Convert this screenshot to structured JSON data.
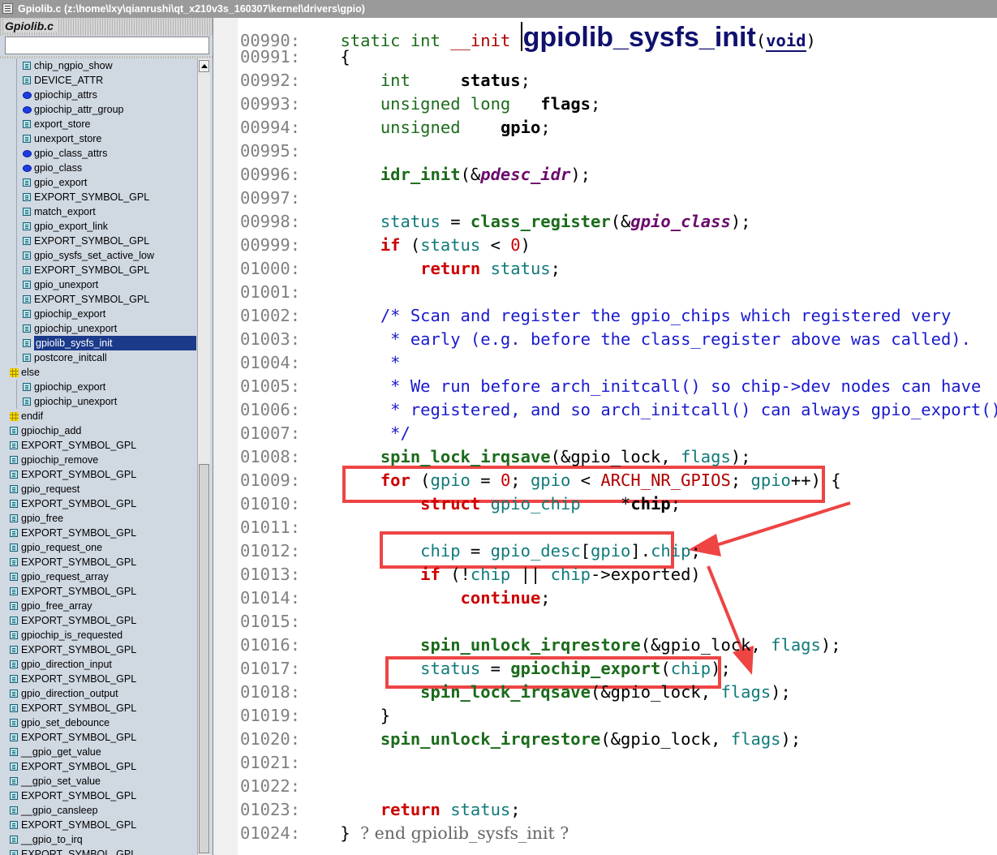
{
  "window": {
    "title": "Gpiolib.c (z:\\home\\lxy\\qianrushi\\qt_x210v3s_160307\\kernel\\drivers\\gpio)"
  },
  "sidebar": {
    "title": "Gpiolib.c",
    "search_value": "",
    "items": [
      {
        "label": "chip_ngpio_show",
        "icon": "function-icon",
        "indent": 2,
        "selected": false
      },
      {
        "label": "DEVICE_ATTR",
        "icon": "function-icon",
        "indent": 2,
        "selected": false
      },
      {
        "label": "gpiochip_attrs",
        "icon": "variable-icon",
        "indent": 2,
        "selected": false
      },
      {
        "label": "gpiochip_attr_group",
        "icon": "variable-icon",
        "indent": 2,
        "selected": false
      },
      {
        "label": "export_store",
        "icon": "function-icon",
        "indent": 2,
        "selected": false
      },
      {
        "label": "unexport_store",
        "icon": "function-icon",
        "indent": 2,
        "selected": false
      },
      {
        "label": "gpio_class_attrs",
        "icon": "variable-icon",
        "indent": 2,
        "selected": false
      },
      {
        "label": "gpio_class",
        "icon": "variable-icon",
        "indent": 2,
        "selected": false
      },
      {
        "label": "gpio_export",
        "icon": "function-icon",
        "indent": 2,
        "selected": false
      },
      {
        "label": "EXPORT_SYMBOL_GPL",
        "icon": "function-icon",
        "indent": 2,
        "selected": false
      },
      {
        "label": "match_export",
        "icon": "function-icon",
        "indent": 2,
        "selected": false
      },
      {
        "label": "gpio_export_link",
        "icon": "function-icon",
        "indent": 2,
        "selected": false
      },
      {
        "label": "EXPORT_SYMBOL_GPL",
        "icon": "function-icon",
        "indent": 2,
        "selected": false
      },
      {
        "label": "gpio_sysfs_set_active_low",
        "icon": "function-icon",
        "indent": 2,
        "selected": false
      },
      {
        "label": "EXPORT_SYMBOL_GPL",
        "icon": "function-icon",
        "indent": 2,
        "selected": false
      },
      {
        "label": "gpio_unexport",
        "icon": "function-icon",
        "indent": 2,
        "selected": false
      },
      {
        "label": "EXPORT_SYMBOL_GPL",
        "icon": "function-icon",
        "indent": 2,
        "selected": false
      },
      {
        "label": "gpiochip_export",
        "icon": "function-icon",
        "indent": 2,
        "selected": false
      },
      {
        "label": "gpiochip_unexport",
        "icon": "function-icon",
        "indent": 2,
        "selected": false
      },
      {
        "label": "gpiolib_sysfs_init",
        "icon": "function-icon",
        "indent": 2,
        "selected": true
      },
      {
        "label": "postcore_initcall",
        "icon": "function-icon",
        "indent": 2,
        "selected": false
      },
      {
        "label": "else",
        "icon": "preprocessor-icon",
        "indent": 0,
        "selected": false
      },
      {
        "label": "gpiochip_export",
        "icon": "function-icon",
        "indent": 2,
        "selected": false
      },
      {
        "label": "gpiochip_unexport",
        "icon": "function-icon",
        "indent": 2,
        "selected": false
      },
      {
        "label": "endif",
        "icon": "preprocessor-icon",
        "indent": 0,
        "selected": false
      },
      {
        "label": "gpiochip_add",
        "icon": "function-icon",
        "indent": 1,
        "selected": false
      },
      {
        "label": "EXPORT_SYMBOL_GPL",
        "icon": "function-icon",
        "indent": 1,
        "selected": false
      },
      {
        "label": "gpiochip_remove",
        "icon": "function-icon",
        "indent": 1,
        "selected": false
      },
      {
        "label": "EXPORT_SYMBOL_GPL",
        "icon": "function-icon",
        "indent": 1,
        "selected": false
      },
      {
        "label": "gpio_request",
        "icon": "function-icon",
        "indent": 1,
        "selected": false
      },
      {
        "label": "EXPORT_SYMBOL_GPL",
        "icon": "function-icon",
        "indent": 1,
        "selected": false
      },
      {
        "label": "gpio_free",
        "icon": "function-icon",
        "indent": 1,
        "selected": false
      },
      {
        "label": "EXPORT_SYMBOL_GPL",
        "icon": "function-icon",
        "indent": 1,
        "selected": false
      },
      {
        "label": "gpio_request_one",
        "icon": "function-icon",
        "indent": 1,
        "selected": false
      },
      {
        "label": "EXPORT_SYMBOL_GPL",
        "icon": "function-icon",
        "indent": 1,
        "selected": false
      },
      {
        "label": "gpio_request_array",
        "icon": "function-icon",
        "indent": 1,
        "selected": false
      },
      {
        "label": "EXPORT_SYMBOL_GPL",
        "icon": "function-icon",
        "indent": 1,
        "selected": false
      },
      {
        "label": "gpio_free_array",
        "icon": "function-icon",
        "indent": 1,
        "selected": false
      },
      {
        "label": "EXPORT_SYMBOL_GPL",
        "icon": "function-icon",
        "indent": 1,
        "selected": false
      },
      {
        "label": "gpiochip_is_requested",
        "icon": "function-icon",
        "indent": 1,
        "selected": false
      },
      {
        "label": "EXPORT_SYMBOL_GPL",
        "icon": "function-icon",
        "indent": 1,
        "selected": false
      },
      {
        "label": "gpio_direction_input",
        "icon": "function-icon",
        "indent": 1,
        "selected": false
      },
      {
        "label": "EXPORT_SYMBOL_GPL",
        "icon": "function-icon",
        "indent": 1,
        "selected": false
      },
      {
        "label": "gpio_direction_output",
        "icon": "function-icon",
        "indent": 1,
        "selected": false
      },
      {
        "label": "EXPORT_SYMBOL_GPL",
        "icon": "function-icon",
        "indent": 1,
        "selected": false
      },
      {
        "label": "gpio_set_debounce",
        "icon": "function-icon",
        "indent": 1,
        "selected": false
      },
      {
        "label": "EXPORT_SYMBOL_GPL",
        "icon": "function-icon",
        "indent": 1,
        "selected": false
      },
      {
        "label": "__gpio_get_value",
        "icon": "function-icon",
        "indent": 1,
        "selected": false
      },
      {
        "label": "EXPORT_SYMBOL_GPL",
        "icon": "function-icon",
        "indent": 1,
        "selected": false
      },
      {
        "label": "__gpio_set_value",
        "icon": "function-icon",
        "indent": 1,
        "selected": false
      },
      {
        "label": "EXPORT_SYMBOL_GPL",
        "icon": "function-icon",
        "indent": 1,
        "selected": false
      },
      {
        "label": "__gpio_cansleep",
        "icon": "function-icon",
        "indent": 1,
        "selected": false
      },
      {
        "label": "EXPORT_SYMBOL_GPL",
        "icon": "function-icon",
        "indent": 1,
        "selected": false
      },
      {
        "label": "__gpio_to_irq",
        "icon": "function-icon",
        "indent": 1,
        "selected": false
      },
      {
        "label": "EXPORT_SYMBOL_GPL",
        "icon": "function-icon",
        "indent": 1,
        "selected": false
      }
    ]
  },
  "editor": {
    "annotation_color": "#ee4444",
    "lines": [
      {
        "num": "00990",
        "tokens": [
          [
            "    ",
            "op"
          ],
          [
            "static",
            "kw"
          ],
          [
            " ",
            "op"
          ],
          [
            "int",
            "kw"
          ],
          [
            " ",
            "op"
          ],
          [
            "__init",
            "mac"
          ],
          [
            " ",
            "op"
          ],
          [
            "|cursor",
            "cursor"
          ],
          [
            "gpiolib_sysfs_init",
            "big"
          ],
          [
            "(",
            "op"
          ],
          [
            "void",
            "voidw"
          ],
          [
            ")",
            "op"
          ]
        ]
      },
      {
        "num": "00991",
        "tokens": [
          [
            "    {",
            "op"
          ]
        ]
      },
      {
        "num": "00992",
        "tokens": [
          [
            "        ",
            "op"
          ],
          [
            "int",
            "ty"
          ],
          [
            "     ",
            "op"
          ],
          [
            "status",
            "var"
          ],
          [
            ";",
            "op"
          ]
        ]
      },
      {
        "num": "00993",
        "tokens": [
          [
            "        ",
            "op"
          ],
          [
            "unsigned long",
            "ty"
          ],
          [
            "   ",
            "op"
          ],
          [
            "flags",
            "var"
          ],
          [
            ";",
            "op"
          ]
        ]
      },
      {
        "num": "00994",
        "tokens": [
          [
            "        ",
            "op"
          ],
          [
            "unsigned",
            "ty"
          ],
          [
            "    ",
            "op"
          ],
          [
            "gpio",
            "var"
          ],
          [
            ";",
            "op"
          ]
        ]
      },
      {
        "num": "00995",
        "tokens": []
      },
      {
        "num": "00996",
        "tokens": [
          [
            "        ",
            "op"
          ],
          [
            "idr_init",
            "fn"
          ],
          [
            "(&",
            "op"
          ],
          [
            "pdesc_idr",
            "gv"
          ],
          [
            ");",
            "op"
          ]
        ]
      },
      {
        "num": "00997",
        "tokens": []
      },
      {
        "num": "00998",
        "tokens": [
          [
            "        ",
            "op"
          ],
          [
            "status",
            "id"
          ],
          [
            " = ",
            "op"
          ],
          [
            "class_register",
            "fn"
          ],
          [
            "(&",
            "op"
          ],
          [
            "gpio_class",
            "gv"
          ],
          [
            ");",
            "op"
          ]
        ]
      },
      {
        "num": "00999",
        "tokens": [
          [
            "        ",
            "op"
          ],
          [
            "if",
            "kwr"
          ],
          [
            " (",
            "op"
          ],
          [
            "status",
            "id"
          ],
          [
            " < ",
            "op"
          ],
          [
            "0",
            "num"
          ],
          [
            ")",
            "op"
          ]
        ]
      },
      {
        "num": "01000",
        "tokens": [
          [
            "            ",
            "op"
          ],
          [
            "return",
            "kwr"
          ],
          [
            " ",
            "op"
          ],
          [
            "status",
            "id"
          ],
          [
            ";",
            "op"
          ]
        ]
      },
      {
        "num": "01001",
        "tokens": []
      },
      {
        "num": "01002",
        "tokens": [
          [
            "        ",
            "op"
          ],
          [
            "/* Scan and register the gpio_chips which registered very",
            "cm"
          ]
        ]
      },
      {
        "num": "01003",
        "tokens": [
          [
            "         ",
            "op"
          ],
          [
            "* early (e.g. before the class_register above was called).",
            "cm"
          ]
        ]
      },
      {
        "num": "01004",
        "tokens": [
          [
            "         ",
            "op"
          ],
          [
            "*",
            "cm"
          ]
        ]
      },
      {
        "num": "01005",
        "tokens": [
          [
            "         ",
            "op"
          ],
          [
            "* We run before arch_initcall() so chip->dev nodes can have",
            "cm"
          ]
        ]
      },
      {
        "num": "01006",
        "tokens": [
          [
            "         ",
            "op"
          ],
          [
            "* registered, and so arch_initcall() can always gpio_export().",
            "cm"
          ]
        ]
      },
      {
        "num": "01007",
        "tokens": [
          [
            "         ",
            "op"
          ],
          [
            "*/",
            "cm"
          ]
        ]
      },
      {
        "num": "01008",
        "tokens": [
          [
            "        ",
            "op"
          ],
          [
            "spin_lock_irqsave",
            "fn"
          ],
          [
            "(&gpio_lock, ",
            "op"
          ],
          [
            "flags",
            "id"
          ],
          [
            ");",
            "op"
          ]
        ]
      },
      {
        "num": "01009",
        "tokens": [
          [
            "        ",
            "op"
          ],
          [
            "for",
            "kwr"
          ],
          [
            " (",
            "op"
          ],
          [
            "gpio",
            "id"
          ],
          [
            " = ",
            "op"
          ],
          [
            "0",
            "num"
          ],
          [
            "; ",
            "op"
          ],
          [
            "gpio",
            "id"
          ],
          [
            " < ",
            "op"
          ],
          [
            "ARCH_NR_GPIOS",
            "mac"
          ],
          [
            "; ",
            "op"
          ],
          [
            "gpio",
            "id"
          ],
          [
            "++) {",
            "op"
          ]
        ]
      },
      {
        "num": "01010",
        "tokens": [
          [
            "            ",
            "op"
          ],
          [
            "struct",
            "kwr"
          ],
          [
            " ",
            "op"
          ],
          [
            "gpio_chip",
            "id"
          ],
          [
            "    *",
            "op"
          ],
          [
            "chip",
            "var"
          ],
          [
            ";",
            "op"
          ]
        ]
      },
      {
        "num": "01011",
        "tokens": []
      },
      {
        "num": "01012",
        "tokens": [
          [
            "            ",
            "op"
          ],
          [
            "chip",
            "id"
          ],
          [
            " = ",
            "op"
          ],
          [
            "gpio_desc",
            "id"
          ],
          [
            "[",
            "op"
          ],
          [
            "gpio",
            "id"
          ],
          [
            "].",
            "op"
          ],
          [
            "chip",
            "id"
          ],
          [
            ";",
            "op"
          ]
        ]
      },
      {
        "num": "01013",
        "tokens": [
          [
            "            ",
            "op"
          ],
          [
            "if",
            "kwr"
          ],
          [
            " (!",
            "op"
          ],
          [
            "chip",
            "id"
          ],
          [
            " || ",
            "op"
          ],
          [
            "chip",
            "id"
          ],
          [
            "->exported)",
            "op"
          ]
        ]
      },
      {
        "num": "01014",
        "tokens": [
          [
            "                ",
            "op"
          ],
          [
            "continue",
            "kwr"
          ],
          [
            ";",
            "op"
          ]
        ]
      },
      {
        "num": "01015",
        "tokens": []
      },
      {
        "num": "01016",
        "tokens": [
          [
            "            ",
            "op"
          ],
          [
            "spin_unlock_irqrestore",
            "fn"
          ],
          [
            "(&gpio_lock, ",
            "op"
          ],
          [
            "flags",
            "id"
          ],
          [
            ");",
            "op"
          ]
        ]
      },
      {
        "num": "01017",
        "tokens": [
          [
            "            ",
            "op"
          ],
          [
            "status",
            "id"
          ],
          [
            " = ",
            "op"
          ],
          [
            "gpiochip_export",
            "fn"
          ],
          [
            "(",
            "op"
          ],
          [
            "chip",
            "id"
          ],
          [
            ");",
            "op"
          ]
        ]
      },
      {
        "num": "01018",
        "tokens": [
          [
            "            ",
            "op"
          ],
          [
            "spin_lock_irqsave",
            "fn"
          ],
          [
            "(&gpio_lock, ",
            "op"
          ],
          [
            "flags",
            "id"
          ],
          [
            ");",
            "op"
          ]
        ]
      },
      {
        "num": "01019",
        "tokens": [
          [
            "        }",
            "op"
          ]
        ]
      },
      {
        "num": "01020",
        "tokens": [
          [
            "        ",
            "op"
          ],
          [
            "spin_unlock_irqrestore",
            "fn"
          ],
          [
            "(&gpio_lock, ",
            "op"
          ],
          [
            "flags",
            "id"
          ],
          [
            ");",
            "op"
          ]
        ]
      },
      {
        "num": "01021",
        "tokens": []
      },
      {
        "num": "01022",
        "tokens": []
      },
      {
        "num": "01023",
        "tokens": [
          [
            "        ",
            "op"
          ],
          [
            "return",
            "kwr"
          ],
          [
            " ",
            "op"
          ],
          [
            "status",
            "id"
          ],
          [
            ";",
            "op"
          ]
        ]
      },
      {
        "num": "01024",
        "tokens": [
          [
            "    } ",
            "op"
          ],
          [
            "? end gpiolib_sysfs_init ?",
            "hash"
          ]
        ]
      }
    ]
  }
}
